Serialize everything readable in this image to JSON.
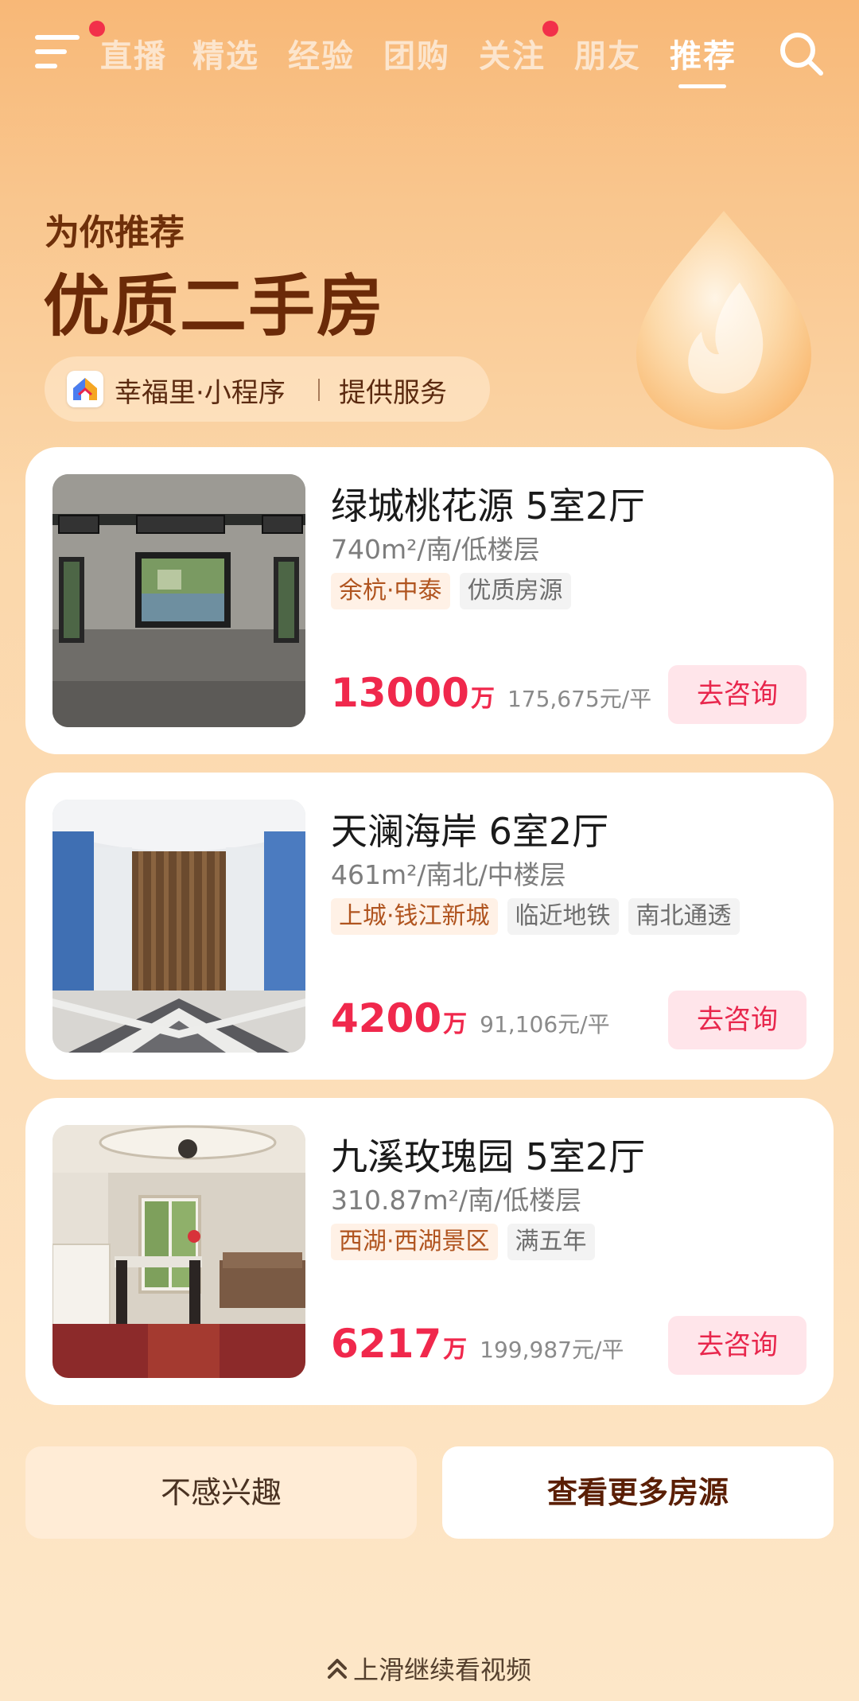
{
  "nav": {
    "tabs": [
      {
        "label": "直播"
      },
      {
        "label": "精选"
      },
      {
        "label": "经验"
      },
      {
        "label": "团购"
      },
      {
        "label": "关注"
      },
      {
        "label": "朋友"
      },
      {
        "label": "推荐"
      }
    ],
    "active_tab": "推荐",
    "icons": {
      "menu": "menu-icon",
      "search": "search-icon"
    },
    "notification_color": "#f2304a"
  },
  "header": {
    "subtitle": "为你推荐",
    "title": "优质二手房",
    "provider_name": "幸福里·小程序",
    "provider_suffix": "提供服务"
  },
  "listings": [
    {
      "name": "绿城桃花源 5室2厅",
      "spec": "740m²/南/低楼层",
      "tags": [
        {
          "text": "余杭·中泰",
          "type": "location"
        },
        {
          "text": "优质房源",
          "type": "feature"
        }
      ],
      "price": "13000",
      "price_unit": "万",
      "unit_price": "175,675元/平",
      "button": "去咨询"
    },
    {
      "name": "天澜海岸 6室2厅",
      "spec": "461m²/南北/中楼层",
      "tags": [
        {
          "text": "上城·钱江新城",
          "type": "location"
        },
        {
          "text": "临近地铁",
          "type": "feature"
        },
        {
          "text": "南北通透",
          "type": "feature"
        }
      ],
      "price": "4200",
      "price_unit": "万",
      "unit_price": "91,106元/平",
      "button": "去咨询"
    },
    {
      "name": "九溪玫瑰园 5室2厅",
      "spec": "310.87m²/南/低楼层",
      "tags": [
        {
          "text": "西湖·西湖景区",
          "type": "location"
        },
        {
          "text": "满五年",
          "type": "feature"
        }
      ],
      "price": "6217",
      "price_unit": "万",
      "unit_price": "199,987元/平",
      "button": "去咨询"
    }
  ],
  "actions": {
    "not_interested": "不感兴趣",
    "more_listings": "查看更多房源"
  },
  "footer": {
    "swipe_hint": "上滑继续看视频"
  },
  "colors": {
    "accent_red": "#f0284c",
    "title_brown": "#6b2a08",
    "background_top": "#f8b877",
    "background_bottom": "#fde7c8"
  }
}
